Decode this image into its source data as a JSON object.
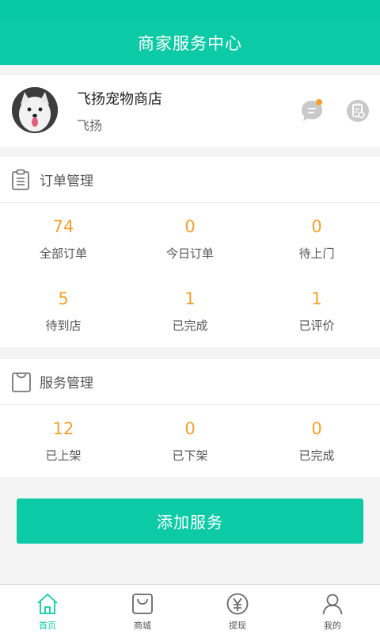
{
  "header": {
    "title": "商家服务中心"
  },
  "profile": {
    "store_name": "飞扬宠物商店",
    "owner_name": "飞扬",
    "message_icon": "message-icon",
    "notify_dot_color": "#f5a030",
    "clipboard_icon": "clipboard-settings-icon"
  },
  "orders": {
    "title": "订单管理",
    "icon": "clipboard-icon",
    "stats": [
      {
        "value": "74",
        "label": "全部订单"
      },
      {
        "value": "0",
        "label": "今日订单"
      },
      {
        "value": "0",
        "label": "待上门"
      },
      {
        "value": "5",
        "label": "待到店"
      },
      {
        "value": "1",
        "label": "已完成"
      },
      {
        "value": "1",
        "label": "已评价"
      }
    ]
  },
  "services": {
    "title": "服务管理",
    "icon": "shopping-bag-icon",
    "stats": [
      {
        "value": "12",
        "label": "已上架"
      },
      {
        "value": "0",
        "label": "已下架"
      },
      {
        "value": "0",
        "label": "已完成"
      }
    ]
  },
  "add_service_label": "添加服务",
  "tabbar": {
    "tabs": [
      {
        "label": "首页",
        "icon": "home-icon",
        "active": true
      },
      {
        "label": "商城",
        "icon": "mall-bag-icon",
        "active": false
      },
      {
        "label": "提现",
        "icon": "yuan-coin-icon",
        "active": false
      },
      {
        "label": "我的",
        "icon": "user-icon",
        "active": false
      }
    ]
  },
  "colors": {
    "accent": "#0ccaa6",
    "stat_value": "#f5a030",
    "background": "#f4f4f4"
  }
}
